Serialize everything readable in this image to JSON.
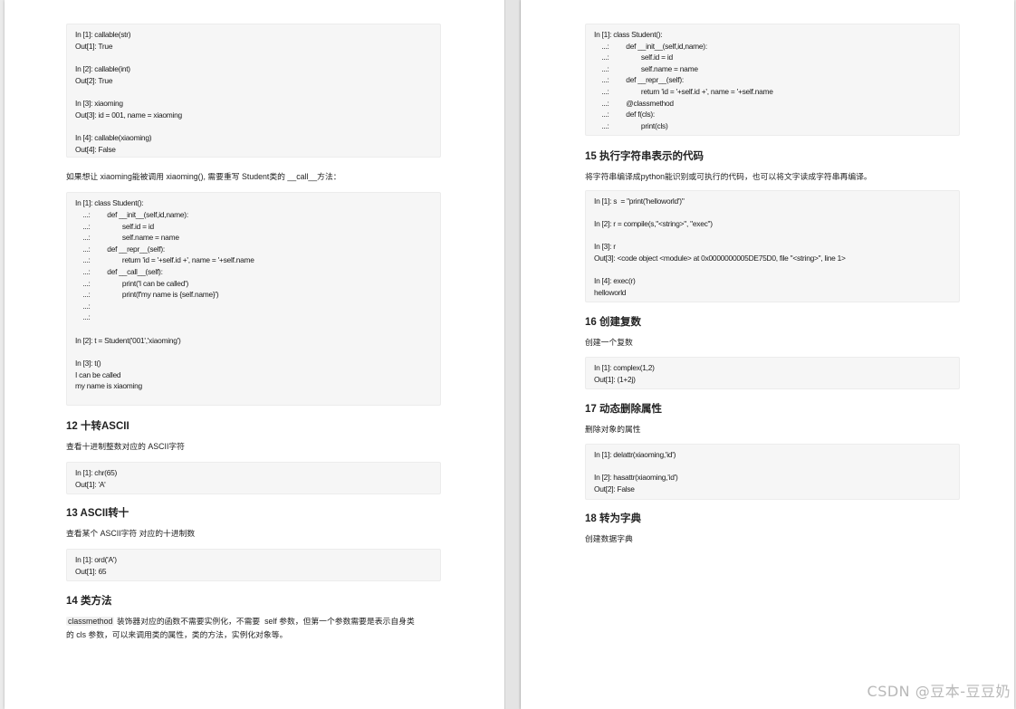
{
  "left": {
    "box1": [
      "In [1]: callable(str)",
      "Out[1]: True",
      "In [2]: callable(int)",
      "Out[2]: True",
      "In [3]: xiaoming",
      "Out[3]: id = 001, name = xiaoming",
      "In [4]: callable(xiaoming)",
      "Out[4]: False"
    ],
    "para1": "如果想让 xiaoming能被调用 xiaoming(), 需要重写 Student类的 __call__方法：",
    "box2": [
      "In [1]: class Student():",
      "    ...:         def __init__(self,id,name):",
      "    ...:                 self.id = id",
      "    ...:                 self.name = name",
      "    ...:         def __repr__(self):",
      "    ...:                 return 'id = '+self.id +', name = '+self.name",
      "    ...:         def __call__(self):",
      "    ...:                 print('I can be called')",
      "    ...:                 print(f'my name is {self.name}')",
      "    ...:",
      "    ...:",
      "In [2]: t = Student('001','xiaoming')",
      "In [3]: t()",
      "I can be called",
      "my name is xiaoming"
    ],
    "h12": "12 十转ASCII",
    "p12": "查看十进制整数对应的 ASCII字符",
    "box12": [
      "In [1]: chr(65)",
      "Out[1]: 'A'"
    ],
    "h13": "13 ASCII转十",
    "p13": "查看某个 ASCII字符 对应的十进制数",
    "box13": [
      "In [1]: ord('A')",
      "Out[1]: 65"
    ],
    "h14": "14 类方法",
    "p14_code": "classmethod",
    "p14_line1": " 装饰器对应的函数不需要实例化，不需要  self 参数，但第一个参数需要是表示自身类",
    "p14_line2": "的 cls 参数，可以来调用类的属性，类的方法，实例化对象等。"
  },
  "right": {
    "box14": [
      "In [1]: class Student():",
      "    ...:         def __init__(self,id,name):",
      "    ...:                 self.id = id",
      "    ...:                 self.name = name",
      "    ...:         def __repr__(self):",
      "    ...:                 return 'id = '+self.id +', name = '+self.name",
      "    ...:         @classmethod",
      "    ...:         def f(cls):",
      "    ...:                 print(cls)"
    ],
    "h15": "15 执行字符串表示的代码",
    "p15": "将字符串编译成python能识别或可执行的代码，也可以将文字读成字符串再编译。",
    "box15": [
      "In [1]: s  = \"print('helloworld')\"",
      "In [2]: r = compile(s,\"<string>\", \"exec\")",
      "In [3]: r",
      "Out[3]: <code object <module> at 0x0000000005DE75D0, file \"<string>\", line 1>",
      "In [4]: exec(r)",
      "helloworld"
    ],
    "h16": "16 创建复数",
    "p16": "创建一个复数",
    "box16": [
      "In [1]: complex(1,2)",
      "Out[1]: (1+2j)"
    ],
    "h17": "17 动态删除属性",
    "p17": "删除对象的属性",
    "box17": [
      "In [1]: delattr(xiaoming,'id')",
      "In [2]: hasattr(xiaoming,'id')",
      "Out[2]: False"
    ],
    "h18": "18 转为字典",
    "p18": "创建数据字典"
  },
  "watermark": "CSDN @豆本-豆豆奶"
}
